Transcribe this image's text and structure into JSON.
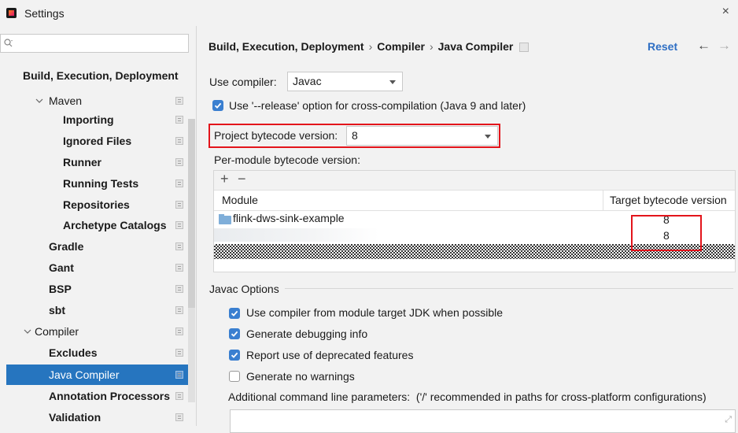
{
  "window": {
    "title": "Settings",
    "close_label": "×"
  },
  "search": {
    "placeholder": ""
  },
  "sidebar": {
    "items": [
      {
        "label": "Build, Execution, Deployment"
      },
      {
        "label": "Maven"
      },
      {
        "label": "Importing"
      },
      {
        "label": "Ignored Files"
      },
      {
        "label": "Runner"
      },
      {
        "label": "Running Tests"
      },
      {
        "label": "Repositories"
      },
      {
        "label": "Archetype Catalogs"
      },
      {
        "label": "Gradle"
      },
      {
        "label": "Gant"
      },
      {
        "label": "BSP"
      },
      {
        "label": "sbt"
      },
      {
        "label": "Compiler"
      },
      {
        "label": "Excludes"
      },
      {
        "label": "Java Compiler"
      },
      {
        "label": "Annotation Processors"
      },
      {
        "label": "Validation"
      }
    ],
    "selected": "Java Compiler",
    "selection_color": "#2675bf"
  },
  "header": {
    "breadcrumb": [
      "Build, Execution, Deployment",
      "Compiler",
      "Java Compiler"
    ],
    "breadcrumb_separator": "›",
    "reset_label": "Reset",
    "back_icon": "←",
    "forward_icon": "→"
  },
  "form": {
    "use_compiler_label": "Use compiler:",
    "use_compiler_value": "Javac",
    "release_option_label": "Use '--release' option for cross-compilation (Java 9 and later)",
    "release_option_checked": true,
    "project_bytecode_label": "Project bytecode version:",
    "project_bytecode_value": "8",
    "per_module_label": "Per-module bytecode version:"
  },
  "table": {
    "add_icon": "+",
    "remove_icon": "−",
    "columns": [
      "Module",
      "Target bytecode version"
    ],
    "rows": [
      {
        "module": "flink-dws-sink-example",
        "version": "8"
      },
      {
        "module": "",
        "version": "8"
      }
    ]
  },
  "javac_options": {
    "section_label": "Javac Options",
    "checkboxes": [
      {
        "label": "Use compiler from module target JDK when possible",
        "checked": true
      },
      {
        "label": "Generate debugging info",
        "checked": true
      },
      {
        "label": "Report use of deprecated features",
        "checked": true
      },
      {
        "label": "Generate no warnings",
        "checked": false
      }
    ],
    "additional_params_label": "Additional command line parameters:",
    "additional_params_hint": "('/' recommended in paths for cross-platform configurations)",
    "additional_params_value": ""
  },
  "colors": {
    "accent": "#3a7fd0",
    "highlight_box": "#e3141b",
    "link": "#2f6fc4"
  }
}
